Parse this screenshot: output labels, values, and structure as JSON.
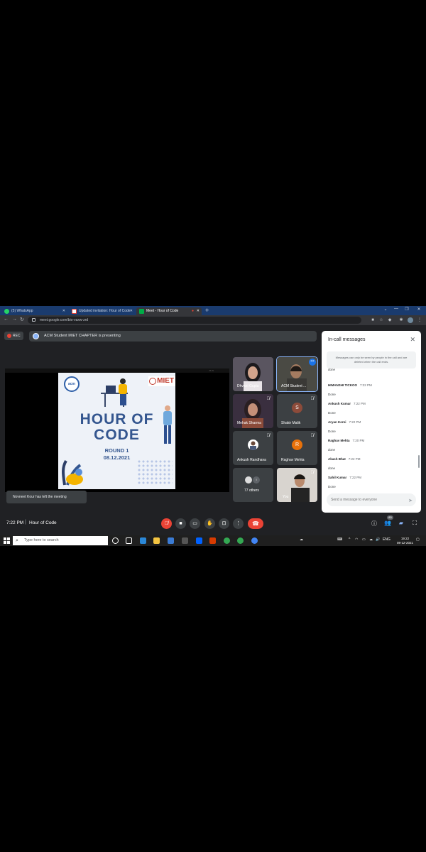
{
  "browser": {
    "tabs": [
      {
        "label": "(5) WhatsApp",
        "icon": "whatsapp-icon",
        "color": "#25d366"
      },
      {
        "label": "Updated invitation: Hour of Code",
        "icon": "gmail-icon",
        "color": "#ea4335"
      },
      {
        "label": "Meet - Hour of Code",
        "icon": "meet-icon",
        "color": "#00ac47"
      }
    ],
    "url": "meet.google.com/bio-vaxw-zrd"
  },
  "meet": {
    "rec_label": "REC",
    "presenting_banner": "ACM Student MIET CHAPTER is presenting",
    "toast": "Novneet Kour has left the meeting",
    "meeting_time": "7:22 PM",
    "meeting_title": "Hour of Code",
    "participant_count": "80",
    "tiles": [
      {
        "name": "Dhvani Gupta",
        "type": "video"
      },
      {
        "name": "ACM Student ...",
        "type": "video"
      },
      {
        "name": "Mehak Sharma",
        "type": "video"
      },
      {
        "name": "Shakir Malik",
        "type": "avatar",
        "initial": "S",
        "color": "#8d4b3a"
      },
      {
        "name": "Ankush Randhava",
        "type": "avatar",
        "initial": "",
        "color": "#ffffff"
      },
      {
        "name": "Raghav Mehta",
        "type": "avatar",
        "initial": "R",
        "color": "#e8710a"
      },
      {
        "name": "77 others",
        "type": "others"
      },
      {
        "name": "You",
        "type": "video"
      }
    ]
  },
  "slide": {
    "title_line1": "HOUR OF",
    "title_line2": "CODE",
    "round": "ROUND 1",
    "date": "08.12.2021",
    "acm_logo": "acm",
    "miet_logo": "MIET"
  },
  "chat": {
    "title": "In-call messages",
    "notice": "Messages can only be seen by people in the call and are deleted when the call ends.",
    "partial": "done",
    "messages": [
      {
        "sender": "HIMANSHI TICKOO",
        "time": "7:22 PM",
        "text": "Done"
      },
      {
        "sender": "Ankush Kumar",
        "time": "7:22 PM",
        "text": "Done"
      },
      {
        "sender": "Aryan Kerni",
        "time": "7:22 PM",
        "text": "Done"
      },
      {
        "sender": "Raghav Mehta",
        "time": "7:20 PM",
        "text": "done"
      },
      {
        "sender": "Akash Bhat",
        "time": "7:22 PM",
        "text": "done"
      },
      {
        "sender": "Sahil Kumar",
        "time": "7:22 PM",
        "text": "Done"
      }
    ],
    "input_placeholder": "Send a message to everyone"
  },
  "taskbar": {
    "search_placeholder": "Type here to search",
    "lang": "ENG",
    "time": "19:22",
    "date": "08-12-2021"
  }
}
